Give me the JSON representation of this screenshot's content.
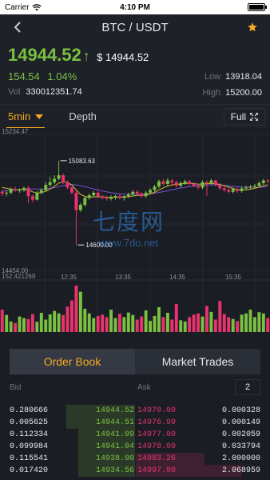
{
  "status": {
    "carrier": "Carrier",
    "time": "4:10 PM"
  },
  "nav": {
    "title": "BTC / USDT"
  },
  "ticker": {
    "last_price": "14944.52",
    "arrow": "↑",
    "fiat_price": "$ 14944.52",
    "change": "154.54",
    "change_pct": "1.04%",
    "vol_label": "Vol",
    "vol_value": "330012351.74",
    "low_label": "Low",
    "low_value": "13918.04",
    "high_label": "High",
    "high_value": "15200.00"
  },
  "chart_tabs": {
    "interval": "5min",
    "depth": "Depth",
    "full": "Full"
  },
  "colors": {
    "up": "#7ac142",
    "down": "#e8336e",
    "accent": "#f6a821",
    "ma_yellow": "#d4b83a",
    "ma_purple": "#7b4fd8"
  },
  "chart_data": {
    "type": "candlestick",
    "y_top_label": "15234.47",
    "y_bottom_label": "14454.00",
    "ylim": [
      14454.0,
      15234.47
    ],
    "max_annotation": "15083.63",
    "min_annotation": "14600.00",
    "x_labels": [
      "12:35",
      "13:35",
      "14:35",
      "15:35"
    ],
    "volume_top_label": "152.421269",
    "volume_max": 152.421269,
    "candles": [
      {
        "o": 14905,
        "c": 14895,
        "h": 14915,
        "l": 14880,
        "v": 72
      },
      {
        "o": 14895,
        "c": 14900,
        "h": 14910,
        "l": 14880,
        "v": 55
      },
      {
        "o": 14900,
        "c": 14920,
        "h": 14930,
        "l": 14890,
        "v": 34
      },
      {
        "o": 14920,
        "c": 14915,
        "h": 14935,
        "l": 14905,
        "v": 29
      },
      {
        "o": 14912,
        "c": 14918,
        "h": 14925,
        "l": 14900,
        "v": 50
      },
      {
        "o": 14918,
        "c": 14928,
        "h": 14935,
        "l": 14905,
        "v": 45
      },
      {
        "o": 14928,
        "c": 14880,
        "h": 14940,
        "l": 14840,
        "v": 42
      },
      {
        "o": 14880,
        "c": 14860,
        "h": 14890,
        "l": 14845,
        "v": 58
      },
      {
        "o": 14860,
        "c": 14900,
        "h": 14910,
        "l": 14855,
        "v": 33
      },
      {
        "o": 14900,
        "c": 14915,
        "h": 14925,
        "l": 14890,
        "v": 62
      },
      {
        "o": 14915,
        "c": 14945,
        "h": 14960,
        "l": 14910,
        "v": 40
      },
      {
        "o": 14945,
        "c": 14960,
        "h": 14990,
        "l": 14935,
        "v": 57
      },
      {
        "o": 14960,
        "c": 14980,
        "h": 15000,
        "l": 14950,
        "v": 68
      },
      {
        "o": 14980,
        "c": 15000,
        "h": 15083.63,
        "l": 14970,
        "v": 60
      },
      {
        "o": 15000,
        "c": 14960,
        "h": 15010,
        "l": 14950,
        "v": 55
      },
      {
        "o": 14960,
        "c": 14930,
        "h": 14970,
        "l": 14920,
        "v": 82
      },
      {
        "o": 14930,
        "c": 14900,
        "h": 14940,
        "l": 14890,
        "v": 102
      },
      {
        "o": 14900,
        "c": 14800,
        "h": 14910,
        "l": 14600,
        "v": 150
      },
      {
        "o": 14800,
        "c": 14830,
        "h": 14840,
        "l": 14790,
        "v": 130
      },
      {
        "o": 14830,
        "c": 14870,
        "h": 14880,
        "l": 14820,
        "v": 75
      },
      {
        "o": 14870,
        "c": 14885,
        "h": 14895,
        "l": 14860,
        "v": 60
      },
      {
        "o": 14885,
        "c": 14900,
        "h": 14910,
        "l": 14875,
        "v": 45
      },
      {
        "o": 14900,
        "c": 14880,
        "h": 14910,
        "l": 14870,
        "v": 52
      },
      {
        "o": 14880,
        "c": 14870,
        "h": 14890,
        "l": 14860,
        "v": 56
      },
      {
        "o": 14870,
        "c": 14865,
        "h": 14880,
        "l": 14855,
        "v": 48
      },
      {
        "o": 14865,
        "c": 14875,
        "h": 14885,
        "l": 14855,
        "v": 72
      },
      {
        "o": 14875,
        "c": 14880,
        "h": 14890,
        "l": 14860,
        "v": 45
      },
      {
        "o": 14880,
        "c": 14870,
        "h": 14890,
        "l": 14860,
        "v": 59
      },
      {
        "o": 14870,
        "c": 14880,
        "h": 14885,
        "l": 14855,
        "v": 48
      },
      {
        "o": 14880,
        "c": 14890,
        "h": 14900,
        "l": 14870,
        "v": 63
      },
      {
        "o": 14890,
        "c": 14905,
        "h": 14915,
        "l": 14880,
        "v": 55
      },
      {
        "o": 14905,
        "c": 14895,
        "h": 14915,
        "l": 14885,
        "v": 40
      },
      {
        "o": 14895,
        "c": 14880,
        "h": 14905,
        "l": 14870,
        "v": 50
      },
      {
        "o": 14880,
        "c": 14900,
        "h": 14910,
        "l": 14870,
        "v": 70
      },
      {
        "o": 14900,
        "c": 14915,
        "h": 14925,
        "l": 14890,
        "v": 36
      },
      {
        "o": 14915,
        "c": 14935,
        "h": 14945,
        "l": 14905,
        "v": 52
      },
      {
        "o": 14935,
        "c": 14965,
        "h": 14975,
        "l": 14925,
        "v": 80
      },
      {
        "o": 14965,
        "c": 14950,
        "h": 14980,
        "l": 14940,
        "v": 48
      },
      {
        "o": 14950,
        "c": 14970,
        "h": 14985,
        "l": 14940,
        "v": 62
      },
      {
        "o": 14970,
        "c": 14960,
        "h": 14980,
        "l": 14945,
        "v": 40
      },
      {
        "o": 14960,
        "c": 14940,
        "h": 14970,
        "l": 14930,
        "v": 90
      },
      {
        "o": 14940,
        "c": 14955,
        "h": 14965,
        "l": 14930,
        "v": 38
      },
      {
        "o": 14955,
        "c": 14965,
        "h": 14975,
        "l": 14945,
        "v": 34
      },
      {
        "o": 14965,
        "c": 14950,
        "h": 14975,
        "l": 14940,
        "v": 48
      },
      {
        "o": 14950,
        "c": 14940,
        "h": 14960,
        "l": 14930,
        "v": 56
      },
      {
        "o": 14940,
        "c": 14930,
        "h": 14950,
        "l": 14920,
        "v": 60
      },
      {
        "o": 14930,
        "c": 14960,
        "h": 14970,
        "l": 14920,
        "v": 50
      },
      {
        "o": 14960,
        "c": 14955,
        "h": 14970,
        "l": 14880,
        "v": 84
      },
      {
        "o": 14955,
        "c": 14970,
        "h": 14980,
        "l": 14945,
        "v": 65
      },
      {
        "o": 14970,
        "c": 14945,
        "h": 14975,
        "l": 14935,
        "v": 40
      },
      {
        "o": 14945,
        "c": 14925,
        "h": 14955,
        "l": 14915,
        "v": 100
      },
      {
        "o": 14925,
        "c": 14915,
        "h": 14935,
        "l": 14905,
        "v": 58
      },
      {
        "o": 14915,
        "c": 14905,
        "h": 14925,
        "l": 14895,
        "v": 48
      },
      {
        "o": 14905,
        "c": 14920,
        "h": 14930,
        "l": 14895,
        "v": 42
      },
      {
        "o": 14920,
        "c": 14910,
        "h": 14930,
        "l": 14900,
        "v": 35
      },
      {
        "o": 14910,
        "c": 14925,
        "h": 14935,
        "l": 14900,
        "v": 56
      },
      {
        "o": 14925,
        "c": 14930,
        "h": 14940,
        "l": 14915,
        "v": 60
      },
      {
        "o": 14930,
        "c": 14935,
        "h": 14945,
        "l": 14920,
        "v": 72
      },
      {
        "o": 14935,
        "c": 14940,
        "h": 14950,
        "l": 14925,
        "v": 48
      },
      {
        "o": 14940,
        "c": 14955,
        "h": 14965,
        "l": 14930,
        "v": 64
      },
      {
        "o": 14955,
        "c": 14970,
        "h": 14980,
        "l": 14945,
        "v": 60
      },
      {
        "o": 14970,
        "c": 14965,
        "h": 14980,
        "l": 14955,
        "v": 45
      }
    ],
    "ma_yellow": [
      14930,
      14925,
      14920,
      14918,
      14917,
      14918,
      14915,
      14905,
      14898,
      14900,
      14908,
      14920,
      14938,
      14955,
      14962,
      14958,
      14945,
      14915,
      14890,
      14878,
      14875,
      14876,
      14877,
      14876,
      14874,
      14873,
      14874,
      14874,
      14875,
      14877,
      14881,
      14884,
      14885,
      14887,
      14893,
      14902,
      14915,
      14928,
      14938,
      14945,
      14948,
      14950,
      14953,
      14954,
      14952,
      14949,
      14950,
      14951,
      14953,
      14952,
      14947,
      14940,
      14932,
      14924,
      14918,
      14915,
      14916,
      14920,
      14925,
      14932,
      14940,
      14946
    ],
    "ma_purple": [
      14910,
      14912,
      14914,
      14915,
      14916,
      14918,
      14920,
      14921,
      14921,
      14921,
      14922,
      14925,
      14929,
      14935,
      14940,
      14944,
      14946,
      14945,
      14940,
      14934,
      14928,
      14922,
      14916,
      14910,
      14905,
      14900,
      14897,
      14894,
      14892,
      14891,
      14891,
      14891,
      14891,
      14892,
      14894,
      14897,
      14901,
      14906,
      14911,
      14917,
      14922,
      14927,
      14931,
      14935,
      14938,
      14940,
      14942,
      14944,
      14945,
      14945,
      14944,
      14942,
      14940,
      14937,
      14935,
      14933,
      14932,
      14931,
      14931,
      14931,
      14932,
      14934
    ]
  },
  "order_book": {
    "tab_orderbook": "Order Book",
    "tab_trades": "Market Trades",
    "bid_label": "Bid",
    "ask_label": "Ask",
    "depth_value": "2",
    "rows": [
      {
        "bid_qty": "0.280666",
        "bid_price": "14944.52",
        "ask_price": "14970.00",
        "ask_qty": "0.000328",
        "bid_depth": 0.55,
        "ask_depth": 0.0
      },
      {
        "bid_qty": "0.005625",
        "bid_price": "14944.51",
        "ask_price": "14976.99",
        "ask_qty": "0.000149",
        "bid_depth": 0.55,
        "ask_depth": 0.0
      },
      {
        "bid_qty": "0.112334",
        "bid_price": "14941.09",
        "ask_price": "14977.00",
        "ask_qty": "0.002059",
        "bid_depth": 0.45,
        "ask_depth": 0.0
      },
      {
        "bid_qty": "0.099984",
        "bid_price": "14941.04",
        "ask_price": "14978.00",
        "ask_qty": "0.033794",
        "bid_depth": 0.45,
        "ask_depth": 0.0
      },
      {
        "bid_qty": "0.115541",
        "bid_price": "14938.00",
        "ask_price": "14983.26",
        "ask_qty": "2.000000",
        "bid_depth": 0.45,
        "ask_depth": 0.55
      },
      {
        "bid_qty": "0.017420",
        "bid_price": "14934.56",
        "ask_price": "14997.90",
        "ask_qty": "2.068959",
        "bid_depth": 0.45,
        "ask_depth": 0.85
      }
    ]
  }
}
